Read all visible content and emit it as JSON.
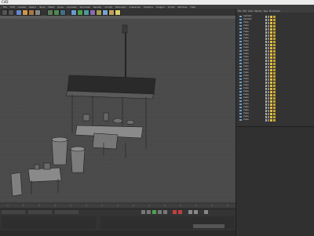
{
  "window": {
    "title": "C4D"
  },
  "menus": [
    "File",
    "Edit",
    "Create",
    "Select",
    "Tools",
    "Mesh",
    "Snap",
    "Animate",
    "Simulate",
    "Render",
    "Sculpt",
    "MoGraph",
    "Character",
    "Pipeline",
    "Plugins",
    "Script",
    "Window",
    "Help"
  ],
  "objects": {
    "tabs": [
      "File",
      "Edit",
      "View",
      "Objects",
      "Tags",
      "Bookmarks"
    ],
    "rows": [
      "Cylinder",
      "Cylinder",
      "Cube",
      "Cube",
      "Cube",
      "Cube",
      "Cube",
      "Cube",
      "Cube",
      "Cube",
      "Cube",
      "Cube",
      "Cube",
      "Cube",
      "Cube",
      "Cube",
      "Cube",
      "Cube",
      "Cube",
      "Cube",
      "Cube",
      "Cube",
      "Cube",
      "Cube",
      "Cube",
      "Cube",
      "Cube",
      "Cube",
      "Cube",
      "Cube",
      "Cube",
      "Cube",
      "Cube",
      "Cube"
    ]
  },
  "colors": {
    "viewport_bg": "#4a4a4a",
    "accent": "#e0c040",
    "panel": "#333333"
  }
}
